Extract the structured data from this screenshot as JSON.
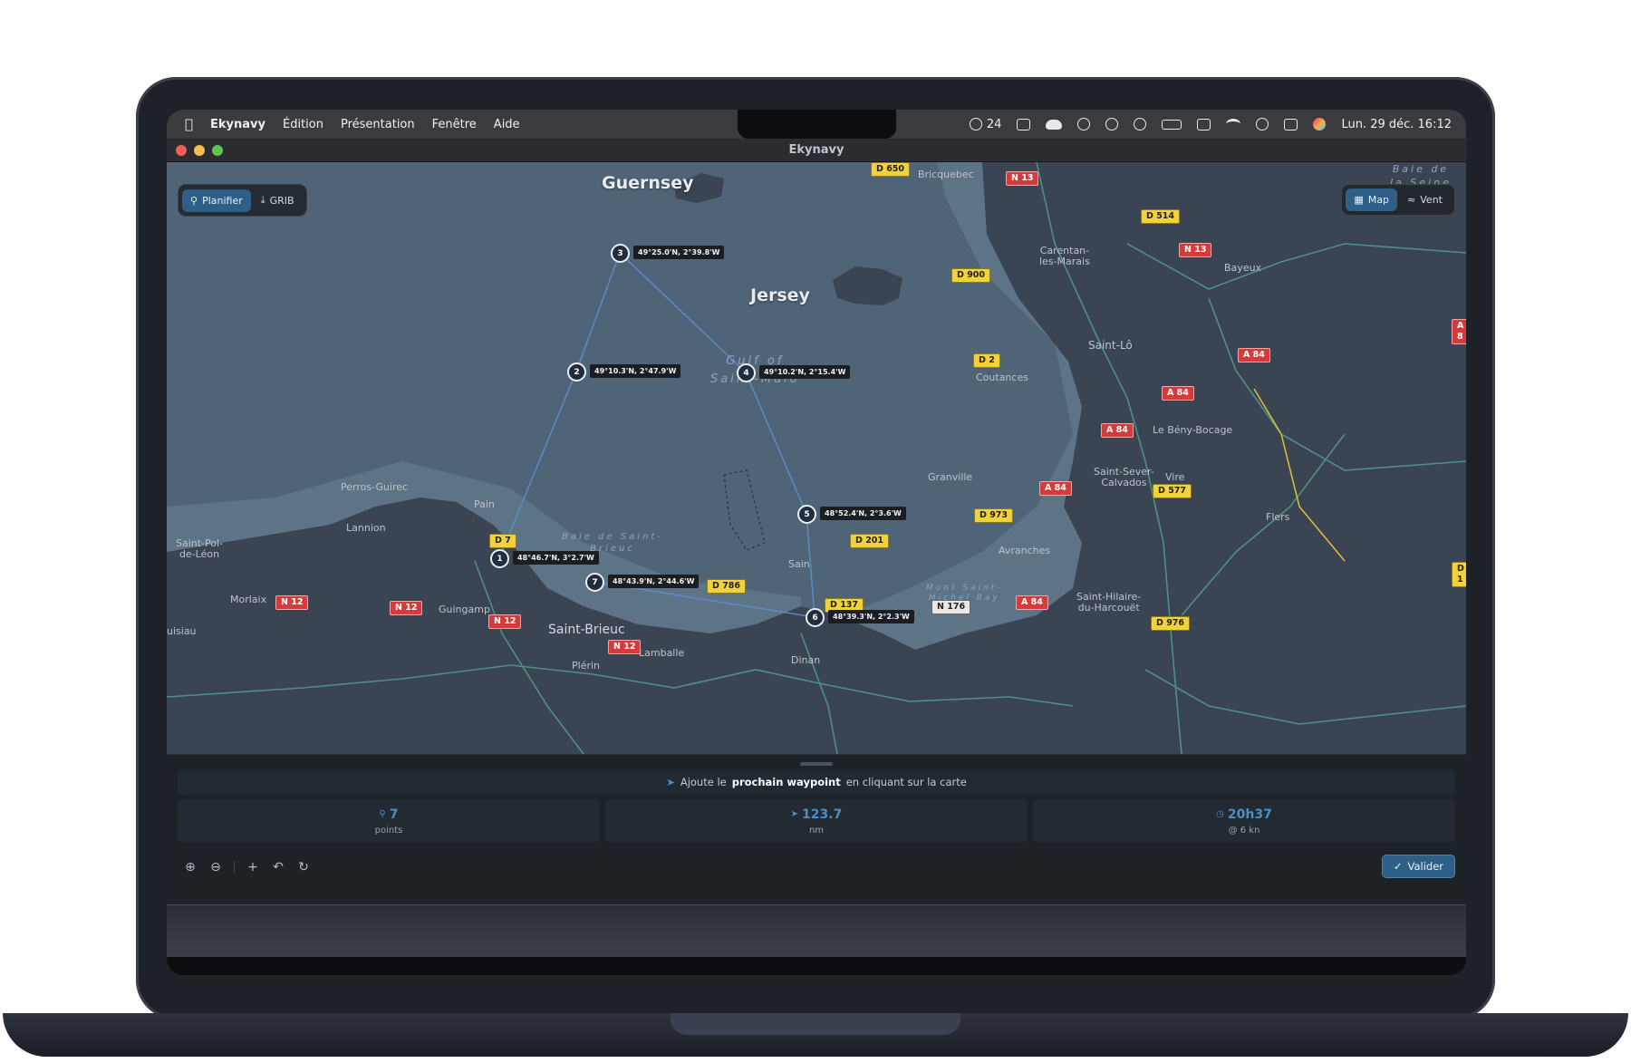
{
  "menubar": {
    "app_name": "Ekynavy",
    "menus": [
      "Édition",
      "Présentation",
      "Fenêtre",
      "Aide"
    ],
    "weather_value": "24",
    "datetime": "Lun. 29 déc.  16:12"
  },
  "window": {
    "title": "Ekynavy"
  },
  "mode_toggle": {
    "plan": "Planifier",
    "grib": "GRIB"
  },
  "layer_toggle": {
    "map": "Map",
    "wind": "Vent"
  },
  "map": {
    "islands": {
      "guernsey": "Guernsey",
      "jersey": "Jersey"
    },
    "water": {
      "gulf": "Gulf of\nSaint-Malo",
      "bay": "Baie de Saint-\nBrieuc",
      "mont": "Mont Saint-\nMichel Bay",
      "seine": "Baie de\nla Seine"
    },
    "towns": {
      "bricquebec": "Bricquebec",
      "carentan": "Carentan-\nles-Marais",
      "bayeux": "Bayeux",
      "saintlo": "Saint-Lô",
      "coutances": "Coutances",
      "beny": "Le Bény-Bocage",
      "saintsever": "Saint-Sever-\nCalvados",
      "vire": "Vire",
      "granville": "Granville",
      "avranches": "Avranches",
      "flers": "Flers",
      "sainthilaire": "Saint-Hilaire-\ndu-Harcouët",
      "perros": "Perros-Guirec",
      "lannion": "Lannion",
      "saintpol": "Saint-Pol-\nde-Léon",
      "morlaix": "Morlaix",
      "guingamp": "Guingamp",
      "lamballe": "Lamballe",
      "plerin": "Plérin",
      "dinan": "Dinan",
      "paimpol": "Pain",
      "saintmalo": "Sain",
      "huelgoat": "uisiau"
    },
    "city": "Saint-Brieuc",
    "roads": {
      "d650": "D 650",
      "n13a": "N 13",
      "d514": "D 514",
      "n13b": "N 13",
      "d900": "D 900",
      "a8": "A 8",
      "a84a": "A 84",
      "d2": "D 2",
      "a84b": "A 84",
      "a84c": "A 84",
      "a84d": "A 84",
      "d577": "D 577",
      "d973": "D 973",
      "d7": "D 7",
      "d201": "D 201",
      "d786": "D 786",
      "d137": "D 137",
      "n176": "N 176",
      "a84e": "A 84",
      "d976": "D 976",
      "d1": "D 1",
      "n12a": "N 12",
      "n12b": "N 12",
      "n12c": "N 12",
      "n12d": "N 12"
    },
    "colors": {
      "sea": "#4f6577",
      "land": "#3b4452",
      "shallow": "#5d7487",
      "route": "#5b8fd0",
      "road": "#4f9a8a"
    }
  },
  "waypoints": [
    {
      "num": "1",
      "coord": "48°46.7'N, 3°2.7'W"
    },
    {
      "num": "2",
      "coord": "49°10.3'N, 2°47.9'W"
    },
    {
      "num": "3",
      "coord": "49°25.0'N, 2°39.8'W"
    },
    {
      "num": "4",
      "coord": "49°10.2'N, 2°15.4'W"
    },
    {
      "num": "5",
      "coord": "48°52.4'N, 2°3.6'W"
    },
    {
      "num": "6",
      "coord": "48°39.3'N, 2°2.3'W"
    },
    {
      "num": "7",
      "coord": "48°43.9'N, 2°44.6'W"
    }
  ],
  "panel": {
    "hint_pre": "Ajoute le",
    "hint_bold": "prochain waypoint",
    "hint_post": "en cliquant sur la carte",
    "stats": [
      {
        "icon": "pin-icon",
        "value": "7",
        "label": "points"
      },
      {
        "icon": "navigation-icon",
        "value": "123.7",
        "label": "nm"
      },
      {
        "icon": "clock-icon",
        "value": "20h37",
        "label": "@ 6 kn"
      }
    ],
    "validate": "Valider"
  }
}
